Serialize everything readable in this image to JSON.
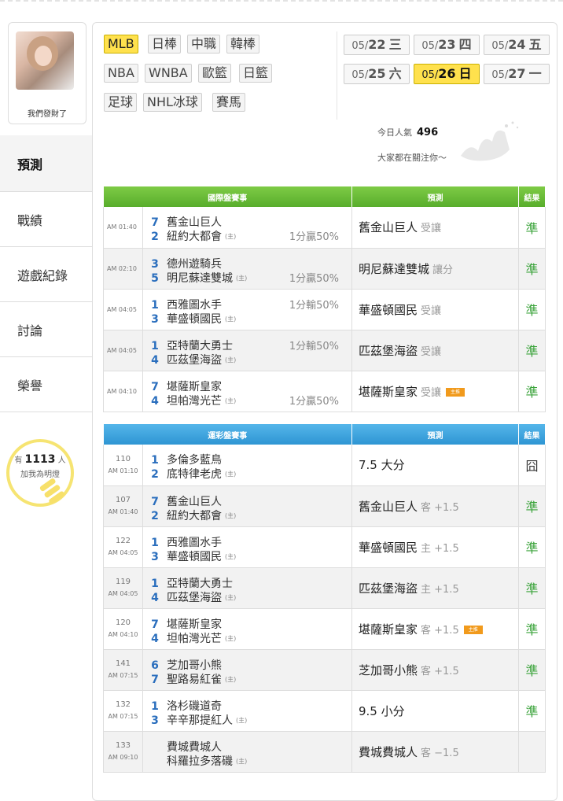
{
  "user": {
    "name": "我們發財了"
  },
  "sidebar": {
    "items": [
      {
        "label": "預測"
      },
      {
        "label": "戰績"
      },
      {
        "label": "遊戲紀錄"
      },
      {
        "label": "討論"
      },
      {
        "label": "榮譽"
      }
    ]
  },
  "fans": {
    "prefix": "有",
    "count": "1113",
    "suffix": "人",
    "line2": "加我為明燈"
  },
  "leagues": {
    "row1": [
      "MLB",
      "日棒",
      "中職",
      "韓棒"
    ],
    "row2": [
      "NBA",
      "WNBA",
      "歐籃",
      "日籃"
    ],
    "row3": [
      "足球",
      "NHL冰球",
      "賽馬"
    ]
  },
  "dates": [
    {
      "md": "05/",
      "d": "22",
      "w": "三"
    },
    {
      "md": "05/",
      "d": "23",
      "w": "四"
    },
    {
      "md": "05/",
      "d": "24",
      "w": "五"
    },
    {
      "md": "05/",
      "d": "25",
      "w": "六"
    },
    {
      "md": "05/",
      "d": "26",
      "w": "日"
    },
    {
      "md": "05/",
      "d": "27",
      "w": "一"
    }
  ],
  "popularity": {
    "label": "今日人氣",
    "value": "496",
    "line2": "大家都在關注你～"
  },
  "intl": {
    "headers": [
      "國際盤賽事",
      "預測",
      "結果"
    ],
    "rows": [
      {
        "time": "AM 01:40",
        "n1": "7",
        "t1": "舊金山巨人",
        "n2": "2",
        "t2": "紐約大都會",
        "h": "(主)",
        "rec": "1分贏50%",
        "recRow": 2,
        "pred": "舊金山巨人",
        "sub": "受讓",
        "badge": "",
        "res": "準"
      },
      {
        "time": "AM 02:10",
        "n1": "3",
        "t1": "德州遊騎兵",
        "n2": "5",
        "t2": "明尼蘇達雙城",
        "h": "(主)",
        "rec": "1分贏50%",
        "recRow": 2,
        "pred": "明尼蘇達雙城",
        "sub": "讓分",
        "badge": "",
        "res": "準"
      },
      {
        "time": "AM 04:05",
        "n1": "1",
        "t1": "西雅圖水手",
        "n2": "3",
        "t2": "華盛頓國民",
        "h": "(主)",
        "rec": "1分輸50%",
        "recRow": 1,
        "pred": "華盛頓國民",
        "sub": "受讓",
        "badge": "",
        "res": "準"
      },
      {
        "time": "AM 04:05",
        "n1": "1",
        "t1": "亞特蘭大勇士",
        "n2": "4",
        "t2": "匹茲堡海盜",
        "h": "(主)",
        "rec": "1分輸50%",
        "recRow": 1,
        "pred": "匹茲堡海盜",
        "sub": "受讓",
        "badge": "",
        "res": "準"
      },
      {
        "time": "AM 04:10",
        "n1": "7",
        "t1": "堪薩斯皇家",
        "n2": "4",
        "t2": "坦帕灣光芒",
        "h": "(主)",
        "rec": "1分贏50%",
        "recRow": 2,
        "pred": "堪薩斯皇家",
        "sub": "受讓",
        "badge": "主推",
        "res": "準"
      }
    ]
  },
  "lottery": {
    "headers": [
      "運彩盤賽事",
      "預測",
      "結果"
    ],
    "rows": [
      {
        "no": "110",
        "time": "AM 01:10",
        "n1": "1",
        "t1": "多倫多藍鳥",
        "n2": "2",
        "t2": "底特律老虎",
        "h": "(主)",
        "pred": "7.5 大分",
        "sub": "",
        "badge": "",
        "res": "囧"
      },
      {
        "no": "107",
        "time": "AM 01:40",
        "n1": "7",
        "t1": "舊金山巨人",
        "n2": "2",
        "t2": "紐約大都會",
        "h": "(主)",
        "pred": "舊金山巨人",
        "sub": "客 +1.5",
        "badge": "",
        "res": "準"
      },
      {
        "no": "122",
        "time": "AM 04:05",
        "n1": "1",
        "t1": "西雅圖水手",
        "n2": "3",
        "t2": "華盛頓國民",
        "h": "(主)",
        "pred": "華盛頓國民",
        "sub": "主 +1.5",
        "badge": "",
        "res": "準"
      },
      {
        "no": "119",
        "time": "AM 04:05",
        "n1": "1",
        "t1": "亞特蘭大勇士",
        "n2": "4",
        "t2": "匹茲堡海盜",
        "h": "(主)",
        "pred": "匹茲堡海盜",
        "sub": "主 +1.5",
        "badge": "",
        "res": "準"
      },
      {
        "no": "120",
        "time": "AM 04:10",
        "n1": "7",
        "t1": "堪薩斯皇家",
        "n2": "4",
        "t2": "坦帕灣光芒",
        "h": "(主)",
        "pred": "堪薩斯皇家",
        "sub": "客 +1.5",
        "badge": "主推",
        "res": "準"
      },
      {
        "no": "141",
        "time": "AM 07:15",
        "n1": "6",
        "t1": "芝加哥小熊",
        "n2": "7",
        "t2": "聖路易紅雀",
        "h": "(主)",
        "pred": "芝加哥小熊",
        "sub": "客 +1.5",
        "badge": "",
        "res": "準"
      },
      {
        "no": "132",
        "time": "AM 07:15",
        "n1": "1",
        "t1": "洛杉磯道奇",
        "n2": "3",
        "t2": "辛辛那提紅人",
        "h": "(主)",
        "pred": "9.5 小分",
        "sub": "",
        "badge": "",
        "res": "準"
      },
      {
        "no": "133",
        "time": "AM 09:10",
        "n1": "",
        "t1": "費城費城人",
        "n2": "",
        "t2": "科羅拉多落磯",
        "h": "(主)",
        "pred": "費城費城人",
        "sub": "客 −1.5",
        "badge": "",
        "res": ""
      }
    ]
  }
}
